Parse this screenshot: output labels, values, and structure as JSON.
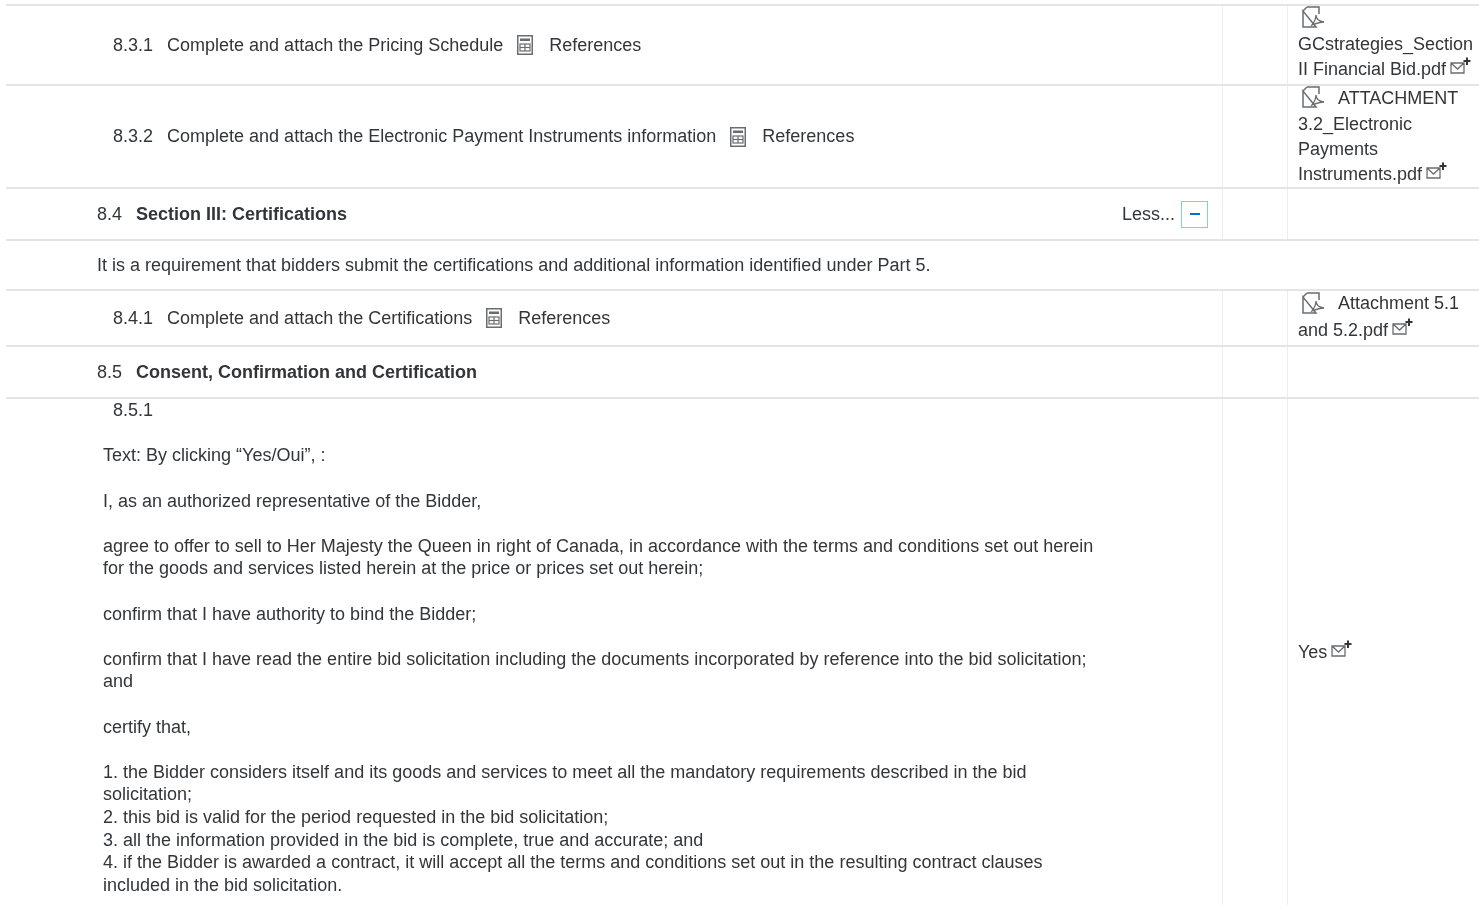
{
  "rows": [
    {
      "kind": "item",
      "number": "8.3.1",
      "title": "Complete and attach the Pricing Schedule",
      "link": "References",
      "attachment": "GCstrategies_Section II Financial Bid.pdf"
    },
    {
      "kind": "item",
      "number": "8.3.2",
      "title": "Complete and attach the Electronic Payment Instruments information",
      "link": "References",
      "attachment": "ATTACHMENT 3.2_Electronic Payments Instruments.pdf"
    },
    {
      "kind": "section",
      "number": "8.4",
      "title": "Section III: Certifications",
      "toggle": "Less...",
      "expanded": true
    },
    {
      "kind": "note",
      "text": "It is a requirement that bidders submit the certifications and additional information identified under Part 5."
    },
    {
      "kind": "item",
      "number": "8.4.1",
      "title": "Complete and attach the Certifications",
      "link": "References",
      "attachment": "Attachment 5.1 and 5.2.pdf"
    },
    {
      "kind": "section",
      "number": "8.5",
      "title": "Consent, Confirmation and Certification"
    },
    {
      "kind": "question",
      "number": "8.5.1",
      "paragraphs": [
        "Text: By clicking “Yes/Oui”, :",
        "I, as an authorized representative of the Bidder,",
        "agree to offer to sell to Her Majesty the Queen in right of Canada, in accordance with the terms and conditions set out herein for the goods and services listed herein at the price or prices set out herein;",
        "confirm that I have authority to bind the Bidder;",
        "confirm that I have read the entire bid solicitation including the documents incorporated by reference into the bid solicitation; and",
        "certify that,"
      ],
      "conditions": [
        "1. the Bidder considers itself and its goods and services to meet all the mandatory requirements described in the bid solicitation;",
        "2. this bid is valid for the period requested in the bid solicitation;",
        "3. all the information provided in the bid is complete, true and accurate; and",
        "4. if the Bidder is awarded a contract, it will accept all the terms and conditions set out in the resulting contract clauses included in the bid solicitation."
      ],
      "answer": "Yes"
    }
  ]
}
